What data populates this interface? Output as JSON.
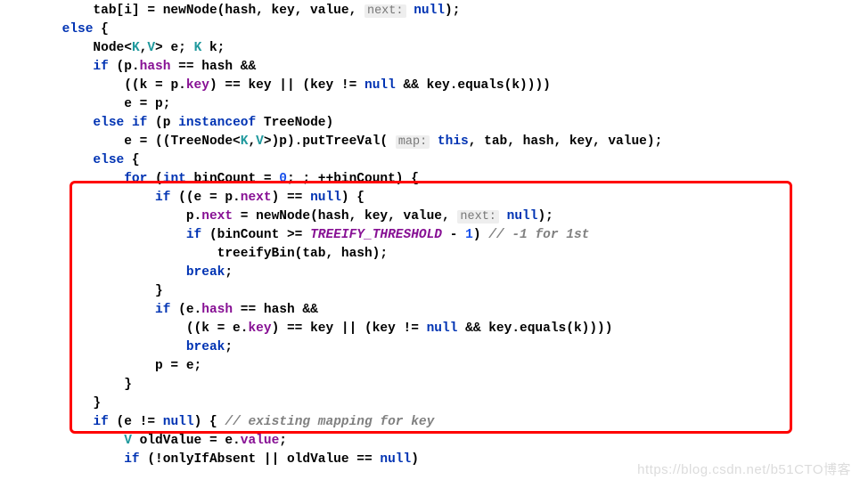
{
  "indent0": "            ",
  "l1a": "tab[i] = newNode(hash, key, value, ",
  "l1_hint": "next:",
  "l1b": " ",
  "l1_null": "null",
  "l1c": ");",
  "indent_else": "        ",
  "l2_else": "else",
  "l2_b": " {",
  "indent1": "            ",
  "l3a": "Node<",
  "l3_K": "K",
  "l3c": ",",
  "l3_V": "V",
  "l3d": "> e; ",
  "l3_K2": "K",
  "l3e": " k;",
  "l4_if": "if",
  "l4a": " (p.",
  "l4_hash": "hash",
  "l4b": " == hash &&",
  "indent2": "                ",
  "l5a": "((k = p.",
  "l5_key": "key",
  "l5b": ") == key || (key != ",
  "l5_null": "null",
  "l5c": " && key.equals(k))))",
  "l6a": "e = p;",
  "l7_else": "else",
  "l7a": " ",
  "l7_if": "if",
  "l7b": " (p ",
  "l7_inst": "instanceof",
  "l7c": " TreeNode)",
  "l8a": "e = ((TreeNode<",
  "l8_K": "K",
  "l8b": ",",
  "l8_V": "V",
  "l8c": ">)p).putTreeVal( ",
  "l8_hint": "map:",
  "l8d": " ",
  "l8_this": "this",
  "l8e": ", tab, hash, key, value);",
  "l9_else": "else",
  "l9a": " {",
  "l10_for": "for",
  "l10a": " (",
  "l10_int": "int",
  "l10b": " binCount = ",
  "l10_zero": "0",
  "l10c": "; ; ++binCount) {",
  "indent3": "                    ",
  "l11_if": "if",
  "l11a": " ((e = p.",
  "l11_next": "next",
  "l11b": ") == ",
  "l11_null": "null",
  "l11c": ") {",
  "indent4": "                        ",
  "l12a": "p.",
  "l12_next": "next",
  "l12b": " = newNode(hash, key, value, ",
  "l12_hint": "next:",
  "l12c": " ",
  "l12_null": "null",
  "l12d": ");",
  "l13_if": "if",
  "l13a": " (binCount >= ",
  "l13_const": "TREEIFY_THRESHOLD",
  "l13b": " - ",
  "l13_one": "1",
  "l13c": ") ",
  "l13_comment": "// -1 for 1st",
  "indent5": "                            ",
  "l14a": "treeifyBin(tab, hash);",
  "l15_break": "break",
  "l15a": ";",
  "l16a": "}",
  "l17_if": "if",
  "l17a": " (e.",
  "l17_hash": "hash",
  "l17b": " == hash &&",
  "l18a": "((k = e.",
  "l18_key": "key",
  "l18b": ") == key || (key != ",
  "l18_null": "null",
  "l18c": " && key.equals(k))))",
  "l19_break": "break",
  "l19a": ";",
  "l20a": "p = e;",
  "l21a": "}",
  "l22a": "}",
  "l23_if": "if",
  "l23a": " (e != ",
  "l23_null": "null",
  "l23b": ") { ",
  "l23_comment": "// existing mapping for key",
  "l24_K": "V",
  "l24a": " oldValue = e.",
  "l24_value": "value",
  "l24b": ";",
  "l25_if": "if",
  "l25a": " (!onlyIfAbsent || oldValue == ",
  "l25_null": "null",
  "l25b": ")",
  "watermark": "https://blog.csdn.net/b51CTO博客"
}
